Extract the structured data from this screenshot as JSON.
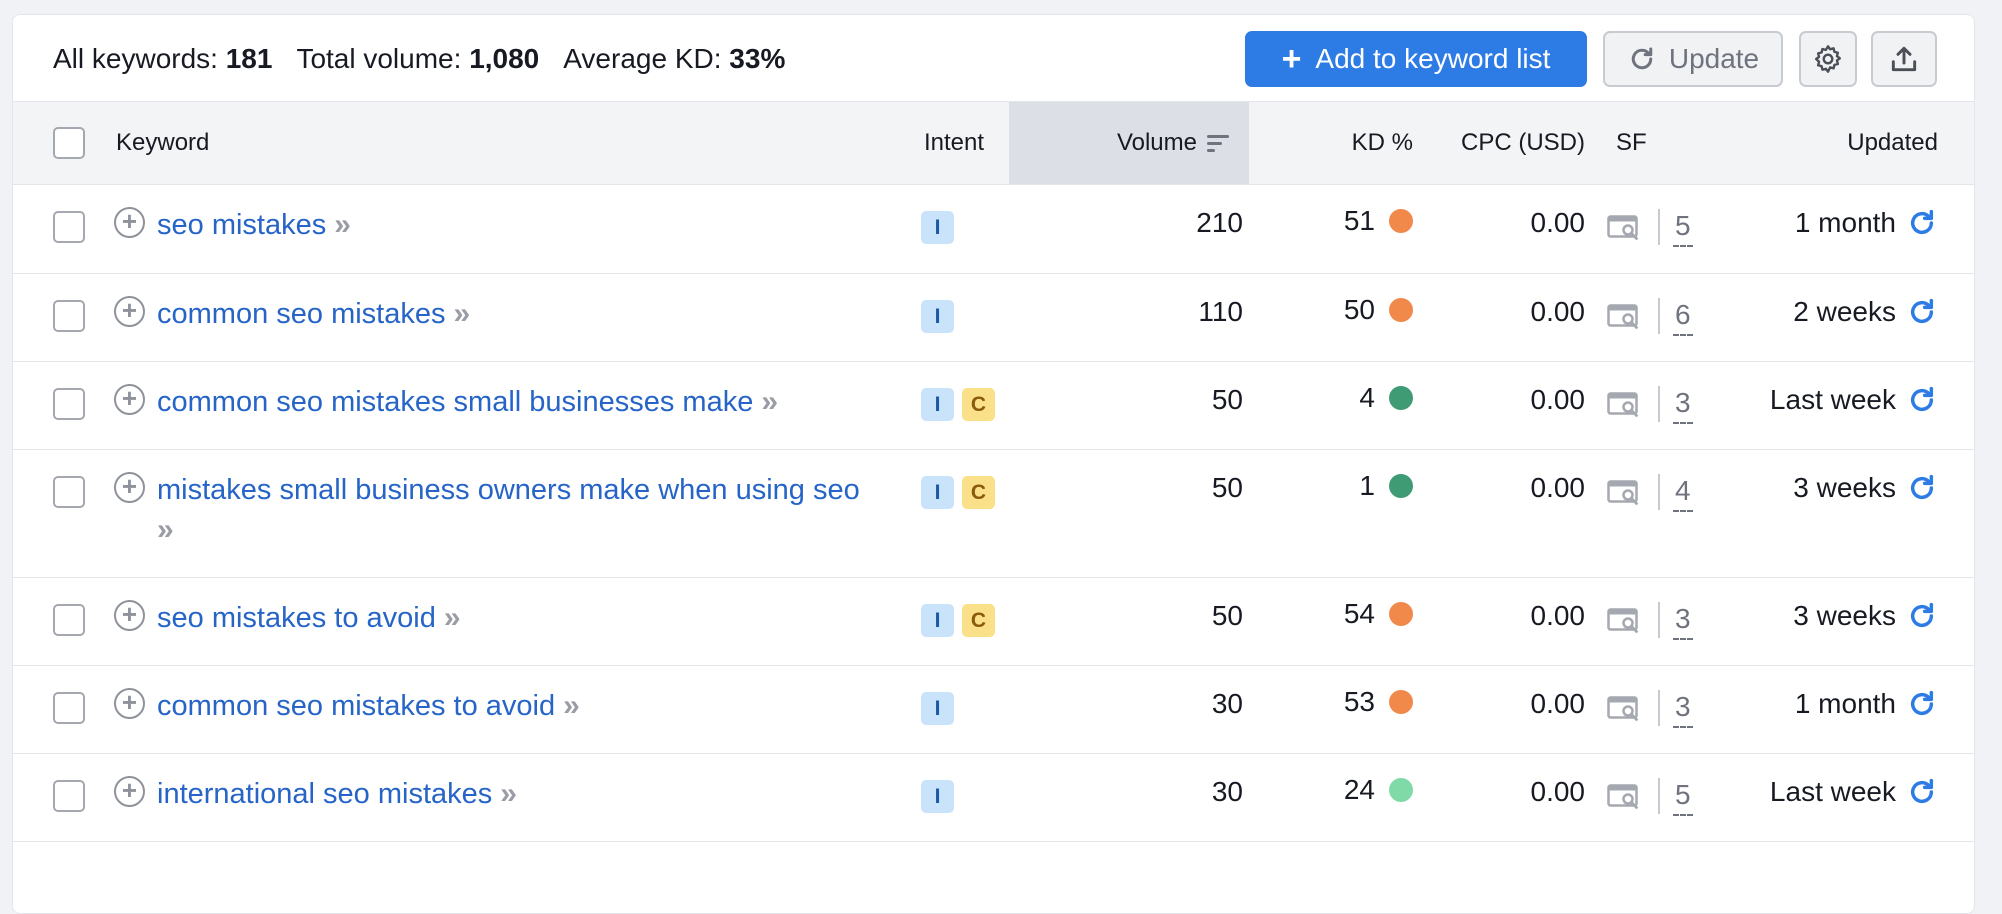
{
  "summary": {
    "all_keywords_label": "All keywords:",
    "all_keywords_value": "181",
    "total_volume_label": "Total volume:",
    "total_volume_value": "1,080",
    "avg_kd_label": "Average KD:",
    "avg_kd_value": "33%"
  },
  "toolbar": {
    "add_label": "Add to keyword list",
    "add_icon": "plus-icon",
    "update_label": "Update",
    "update_icon": "refresh-icon",
    "settings_icon": "gear-icon",
    "export_icon": "upload-icon"
  },
  "columns": {
    "keyword": "Keyword",
    "intent": "Intent",
    "volume": "Volume",
    "kd": "KD %",
    "cpc": "CPC (USD)",
    "sf": "SF",
    "updated": "Updated"
  },
  "colors": {
    "accent": "#2d7be5",
    "link": "#2664c8",
    "kd_orange": "#f0894a",
    "kd_dark_green": "#3f9b74",
    "kd_light_green": "#7fdaa8"
  },
  "rows": [
    {
      "keyword": "seo mistakes",
      "intents": [
        "I"
      ],
      "volume": "210",
      "kd": "51",
      "kd_color": "#f0894a",
      "cpc": "0.00",
      "sf": "5",
      "updated": "1 month"
    },
    {
      "keyword": "common seo mistakes",
      "intents": [
        "I"
      ],
      "volume": "110",
      "kd": "50",
      "kd_color": "#f0894a",
      "cpc": "0.00",
      "sf": "6",
      "updated": "2 weeks"
    },
    {
      "keyword": "common seo mistakes small businesses make",
      "intents": [
        "I",
        "C"
      ],
      "volume": "50",
      "kd": "4",
      "kd_color": "#3f9b74",
      "cpc": "0.00",
      "sf": "3",
      "updated": "Last week"
    },
    {
      "keyword": "mistakes small business owners make when using seo",
      "intents": [
        "I",
        "C"
      ],
      "volume": "50",
      "kd": "1",
      "kd_color": "#3f9b74",
      "cpc": "0.00",
      "sf": "4",
      "updated": "3 weeks"
    },
    {
      "keyword": "seo mistakes to avoid",
      "intents": [
        "I",
        "C"
      ],
      "volume": "50",
      "kd": "54",
      "kd_color": "#f0894a",
      "cpc": "0.00",
      "sf": "3",
      "updated": "3 weeks"
    },
    {
      "keyword": "common seo mistakes to avoid",
      "intents": [
        "I"
      ],
      "volume": "30",
      "kd": "53",
      "kd_color": "#f0894a",
      "cpc": "0.00",
      "sf": "3",
      "updated": "1 month"
    },
    {
      "keyword": "international seo mistakes",
      "intents": [
        "I"
      ],
      "volume": "30",
      "kd": "24",
      "kd_color": "#7fdaa8",
      "cpc": "0.00",
      "sf": "5",
      "updated": "Last week"
    }
  ]
}
